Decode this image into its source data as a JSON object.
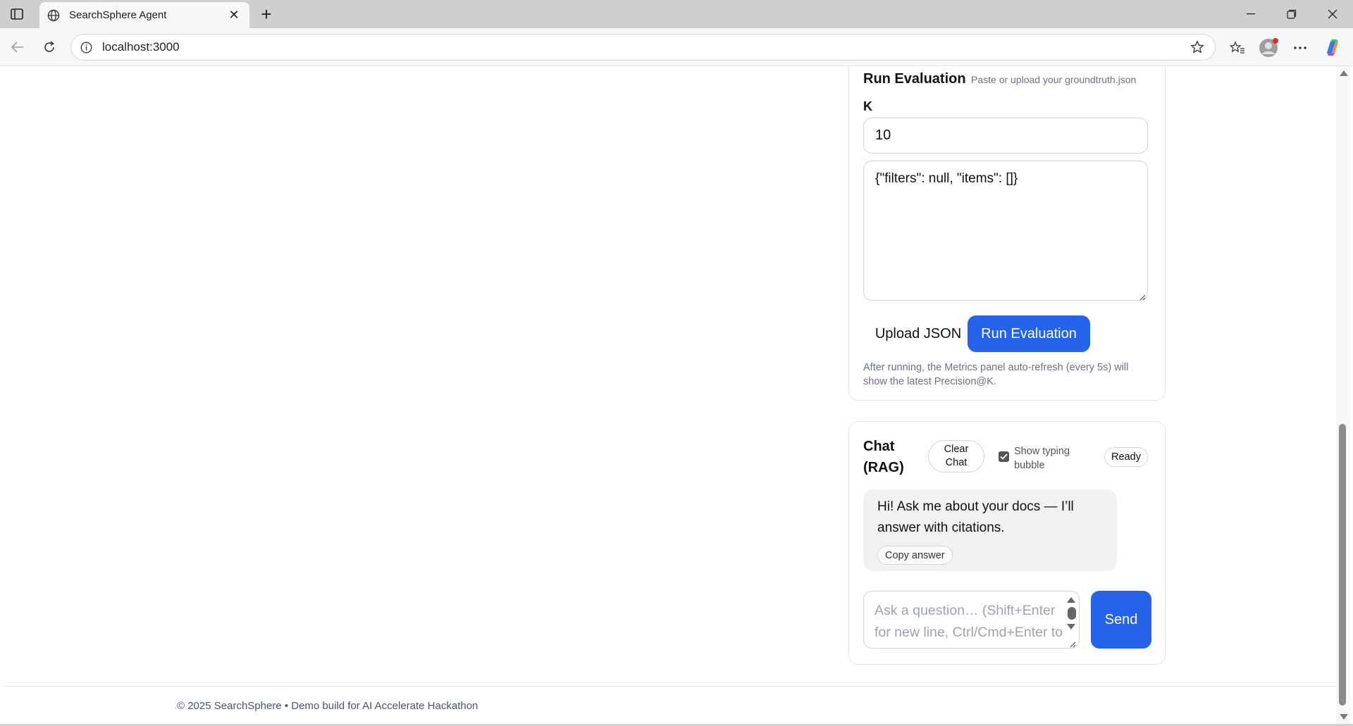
{
  "browser": {
    "tab_title": "SearchSphere Agent",
    "url": "localhost:3000"
  },
  "evaluation": {
    "title": "Run Evaluation",
    "subtitle": "Paste or upload your groundtruth.json",
    "k_label": "K",
    "k_value": "10",
    "json_value": "{\"filters\": null, \"items\": []}",
    "upload_label": "Upload JSON",
    "run_label": "Run Evaluation",
    "note": "After running, the Metrics panel auto-refresh (every 5s) will show the latest Precision@K."
  },
  "chat": {
    "title": "Chat (RAG)",
    "clear_label": "Clear Chat",
    "typing_label": "Show typing bubble",
    "typing_checked": true,
    "status": "Ready",
    "messages": [
      {
        "text": "Hi! Ask me about your docs — I’ll answer with citations.",
        "copy_label": "Copy answer"
      }
    ],
    "input_placeholder": "Ask a question… (Shift+Enter for new line, Ctrl/Cmd+Enter to send)",
    "send_label": "Send"
  },
  "footer": {
    "text": "© 2025 SearchSphere • Demo build for AI Accelerate Hackathon"
  },
  "colors": {
    "accent": "#2563eb",
    "muted_text": "#6b7280",
    "border": "#e4e4e7"
  }
}
